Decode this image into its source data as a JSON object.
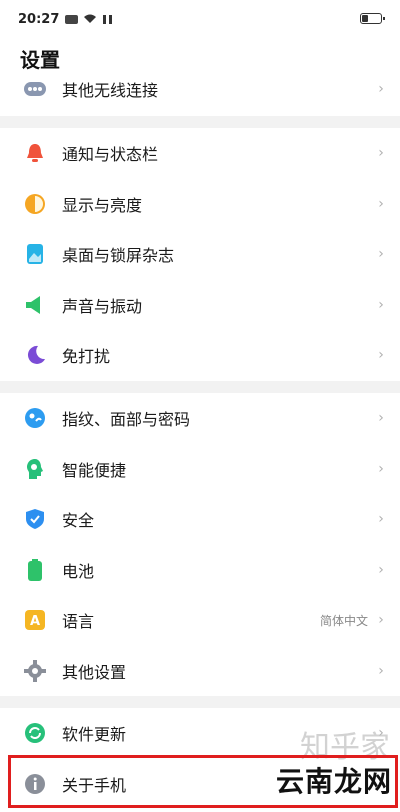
{
  "status_bar": {
    "time": "20:27",
    "icons": [
      "message-icon",
      "wifi-icon",
      "data-icon",
      "battery-icon"
    ]
  },
  "header": {
    "title": "设置"
  },
  "groups": [
    {
      "items": [
        {
          "label": "其他无线连接",
          "icon": "more-dots-icon",
          "color": "#8a97b0"
        }
      ]
    },
    {
      "items": [
        {
          "label": "通知与状态栏",
          "icon": "bell-icon",
          "color": "#f0533b"
        },
        {
          "label": "显示与亮度",
          "icon": "brightness-icon",
          "color": "#f5a623"
        },
        {
          "label": "桌面与锁屏杂志",
          "icon": "wallpaper-icon",
          "color": "#27b3e6"
        },
        {
          "label": "声音与振动",
          "icon": "speaker-icon",
          "color": "#2ec26a"
        },
        {
          "label": "免打扰",
          "icon": "moon-icon",
          "color": "#7b4cd6"
        }
      ]
    },
    {
      "items": [
        {
          "label": "指纹、面部与密码",
          "icon": "fingerprint-icon",
          "color": "#2d9cf0"
        },
        {
          "label": "智能便捷",
          "icon": "smart-assist-icon",
          "color": "#27c07a"
        },
        {
          "label": "安全",
          "icon": "shield-icon",
          "color": "#2d8ff0"
        },
        {
          "label": "电池",
          "icon": "battery-icon",
          "color": "#2ec26a"
        },
        {
          "label": "语言",
          "icon": "language-icon",
          "color": "#f5b623",
          "value": "简体中文"
        },
        {
          "label": "其他设置",
          "icon": "gear-icon",
          "color": "#8a8f99"
        }
      ]
    },
    {
      "items": [
        {
          "label": "软件更新",
          "icon": "update-icon",
          "color": "#27c07a"
        },
        {
          "label": "关于手机",
          "icon": "info-icon",
          "color": "#8a8f99"
        }
      ]
    }
  ],
  "chevron": "›",
  "watermark": {
    "text": "云南龙网",
    "faint": "知乎家"
  }
}
